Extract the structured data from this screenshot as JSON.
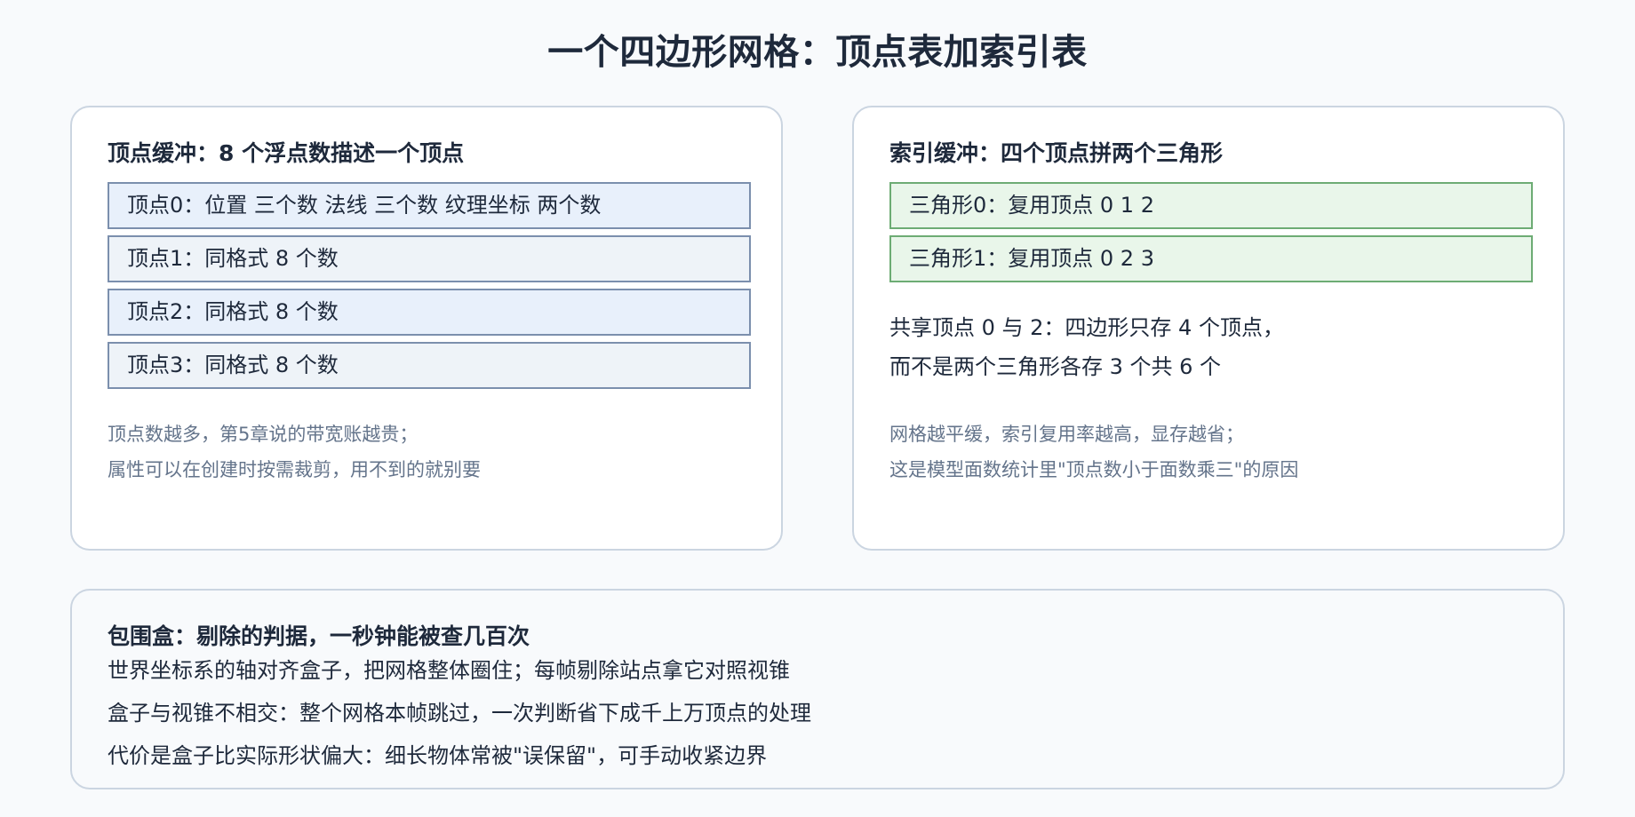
{
  "title": "一个四边形网格：顶点表加索引表",
  "vertex_panel": {
    "title": "顶点缓冲：8 个浮点数描述一个顶点",
    "rows": [
      "顶点0：位置 三个数 法线 三个数 纹理坐标 两个数",
      "顶点1：同格式 8 个数",
      "顶点2：同格式 8 个数",
      "顶点3：同格式 8 个数"
    ],
    "notes": [
      "顶点数越多，第5章说的带宽账越贵；",
      "属性可以在创建时按需裁剪，用不到的就别要"
    ]
  },
  "index_panel": {
    "title": "索引缓冲：四个顶点拼两个三角形",
    "rows": [
      "三角形0：复用顶点 0 1 2",
      "三角形1：复用顶点 0 2 3"
    ],
    "shared": [
      "共享顶点 0 与 2：四边形只存 4 个顶点，",
      "而不是两个三角形各存 3 个共 6 个"
    ],
    "notes": [
      "网格越平缓，索引复用率越高，显存越省；",
      "这是模型面数统计里\"顶点数小于面数乘三\"的原因"
    ]
  },
  "bbox_panel": {
    "title": "包围盒：剔除的判据，一秒钟能被查几百次",
    "lines": [
      "世界坐标系的轴对齐盒子，把网格整体圈住；每帧剔除站点拿它对照视锥",
      "盒子与视锥不相交：整个网格本帧跳过，一次判断省下成千上万顶点的处理",
      "代价是盒子比实际形状偏大：细长物体常被\"误保留\"，可手动收紧边界"
    ]
  }
}
